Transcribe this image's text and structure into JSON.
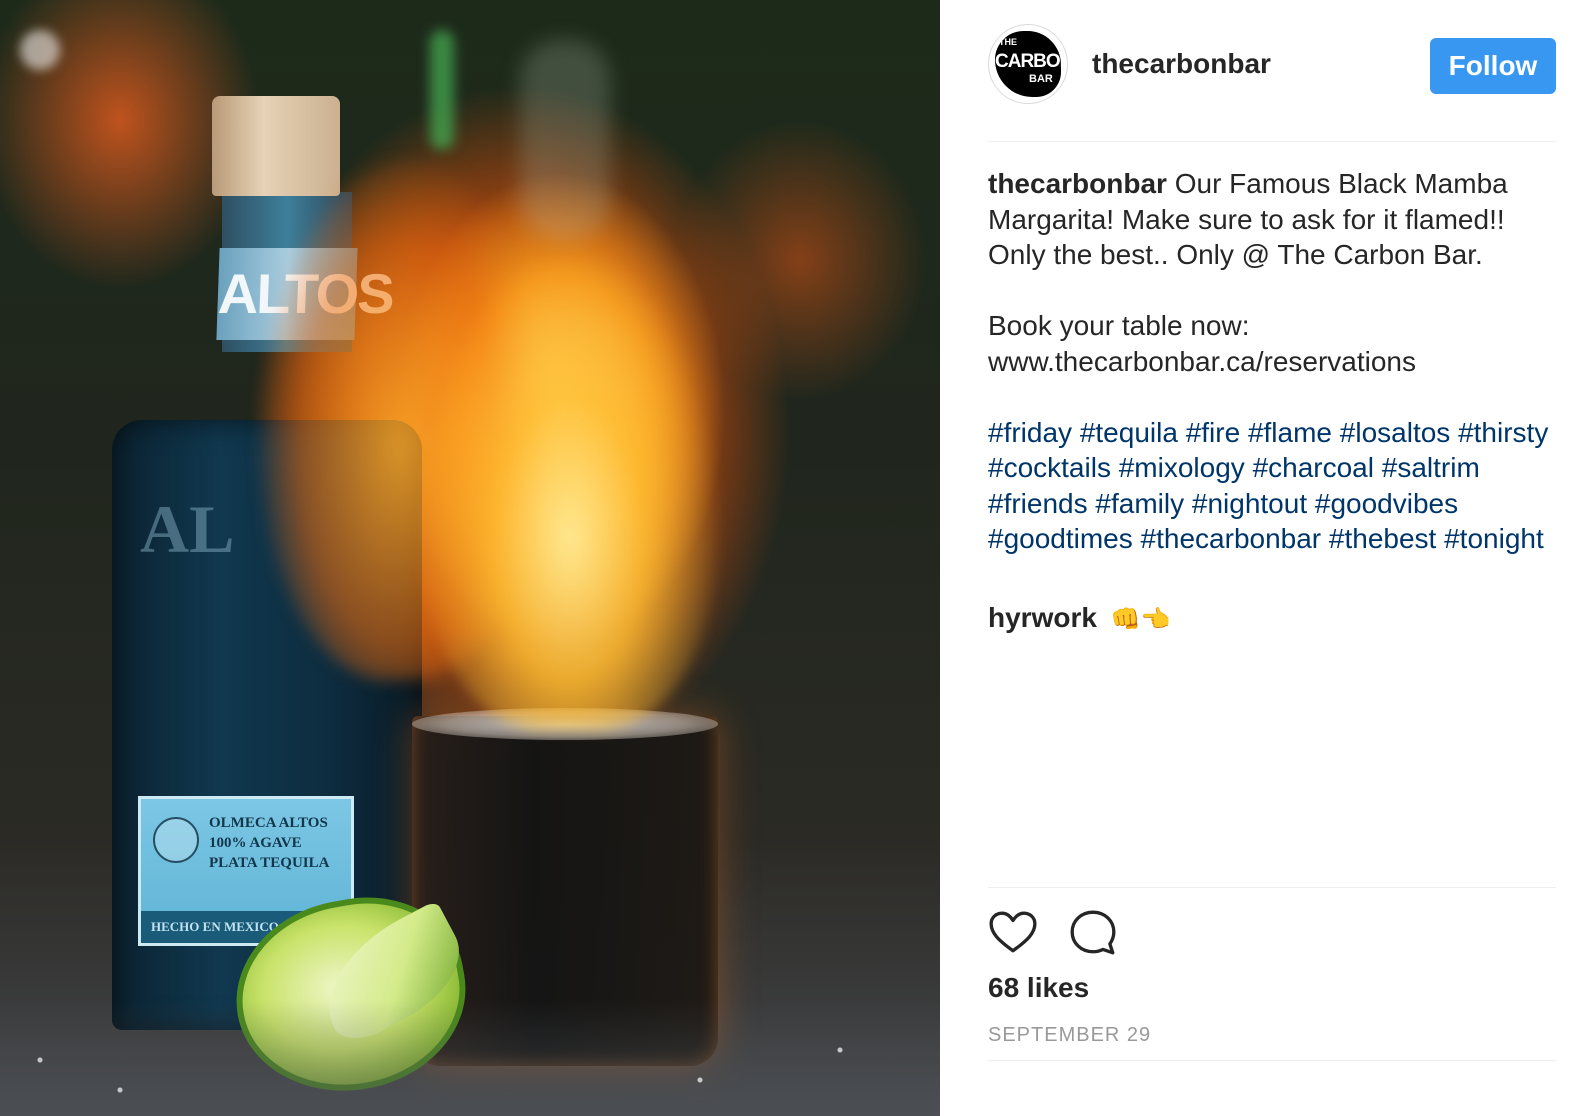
{
  "photo": {
    "neck_label": "ALTOS",
    "emboss": "AL",
    "label_lines": [
      "OLMECA ALTOS",
      "100% AGAVE",
      "PLATA TEQUILA"
    ],
    "label_strip": "HECHO EN MEXICO"
  },
  "header": {
    "avatar_lines": [
      "THE",
      "CARBON",
      "BAR"
    ],
    "username": "thecarbonbar",
    "follow_label": "Follow"
  },
  "caption": {
    "author": "thecarbonbar",
    "text": " Our Famous Black Mamba Margarita! Make sure to ask for it flamed!! Only the best.. Only @ The Carbon Bar.",
    "booking": "Book your table now: www.thecarbonbar.ca/reservations",
    "hashtags": [
      "#friday",
      "#tequila",
      "#fire",
      "#flame",
      "#losaltos",
      "#thirsty",
      "#cocktails",
      "#mixology",
      "#charcoal",
      "#saltrim",
      "#friends",
      "#family",
      "#nightout",
      "#goodvibes",
      "#goodtimes",
      "#thecarbonbar",
      "#thebest",
      "#tonight"
    ]
  },
  "comment": {
    "user": "hyrwork",
    "emoji": "👊👈"
  },
  "engagement": {
    "like_icon": "heart-icon",
    "comment_icon": "comment-icon",
    "likes": "68 likes",
    "date": "SEPTEMBER 29"
  },
  "colors": {
    "follow_button": "#3897f0",
    "hashtag": "#003569",
    "date": "#999999"
  }
}
